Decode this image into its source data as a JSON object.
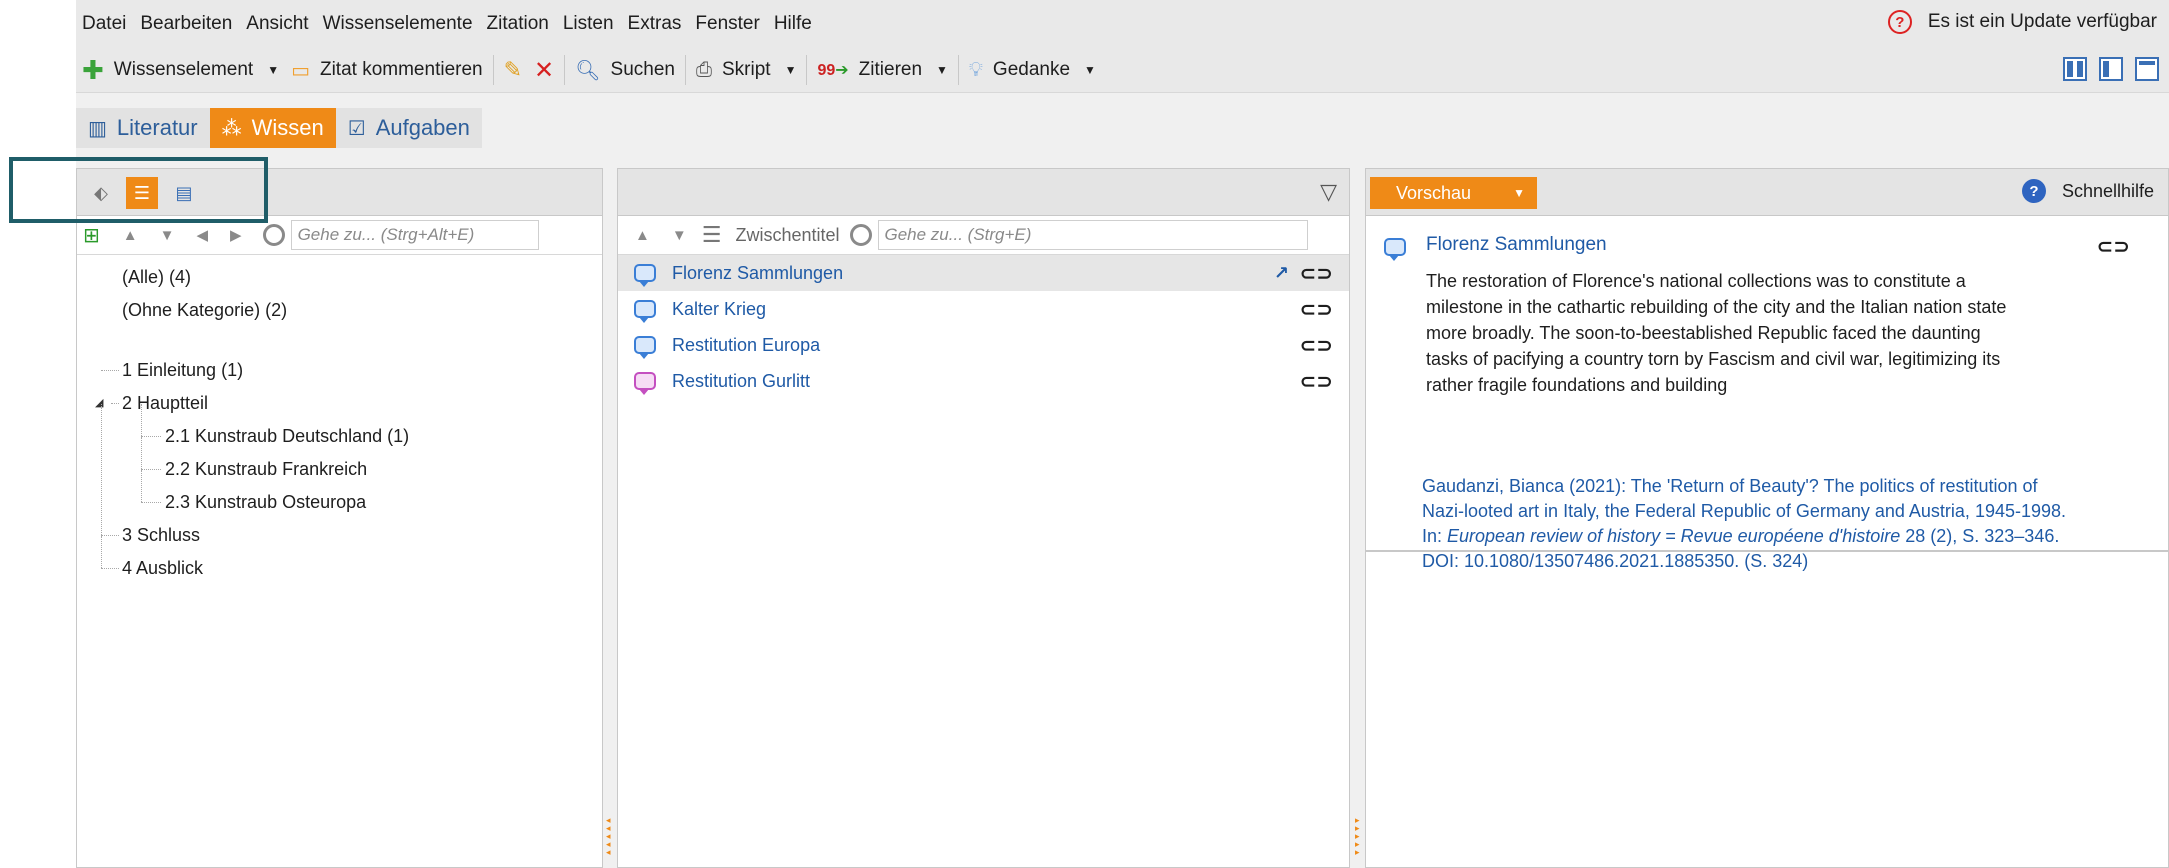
{
  "menu": [
    "Datei",
    "Bearbeiten",
    "Ansicht",
    "Wissenselemente",
    "Zitation",
    "Listen",
    "Extras",
    "Fenster",
    "Hilfe"
  ],
  "update_notice": "Es ist ein Update verfügbar",
  "toolbar": {
    "wissenselement": "Wissenselement",
    "zitat_kommentieren": "Zitat kommentieren",
    "suchen": "Suchen",
    "skript": "Skript",
    "zitieren": "Zitieren",
    "gedanke": "Gedanke"
  },
  "mode_tabs": [
    {
      "label": "Literatur",
      "active": false
    },
    {
      "label": "Wissen",
      "active": true
    },
    {
      "label": "Aufgaben",
      "active": false
    }
  ],
  "left": {
    "goto_placeholder": "Gehe zu... (Strg+Alt+E)",
    "tree": [
      {
        "label": "(Alle) (4)"
      },
      {
        "label": "(Ohne Kategorie) (2)"
      },
      {
        "label": "1 Einleitung (1)"
      },
      {
        "label": "2 Hauptteil"
      },
      {
        "label": "2.1 Kunstraub Deutschland (1)"
      },
      {
        "label": "2.2 Kunstraub Frankreich"
      },
      {
        "label": "2.3 Kunstraub Osteuropa"
      },
      {
        "label": "3 Schluss"
      },
      {
        "label": "4 Ausblick"
      }
    ]
  },
  "middle": {
    "zwischentitel": "Zwischentitel",
    "goto_placeholder": "Gehe zu... (Strg+E)",
    "items": [
      {
        "label": "Florenz Sammlungen",
        "color": "blue",
        "selected": true
      },
      {
        "label": "Kalter Krieg",
        "color": "blue",
        "selected": false
      },
      {
        "label": "Restitution Europa",
        "color": "blue",
        "selected": false
      },
      {
        "label": "Restitution Gurlitt",
        "color": "pink",
        "selected": false
      }
    ]
  },
  "right": {
    "vorschau": "Vorschau",
    "schnellhilfe": "Schnellhilfe",
    "title": "Florenz Sammlungen",
    "body_lines": [
      "The restoration of Florence's national collections was to constitute a",
      "milestone in the cathartic rebuilding of the city and the Italian nation state",
      "more broadly. The soon-to-beestablished Republic faced the daunting",
      "tasks of pacifying a country torn by Fascism and civil war, legitimizing its",
      "rather fragile foundations and building"
    ],
    "citation": {
      "line1": "Gaudanzi, Bianca (2021): The 'Return of Beauty'? The politics of restitution of",
      "line2": "Nazi-looted art in Italy, the Federal Republic of Germany and Austria, 1945-1998.",
      "in": "In: ",
      "journal": "European review of history = Revue européene d'histoire",
      "after_journal": " 28 (2), S. 323–346.",
      "line4": "DOI: 10.1080/13507486.2021.1885350. (S. 324)"
    }
  },
  "colors": {
    "accent": "#ef8a17",
    "link": "#1f5aa6",
    "highlight_frame": "#1f5d68"
  }
}
